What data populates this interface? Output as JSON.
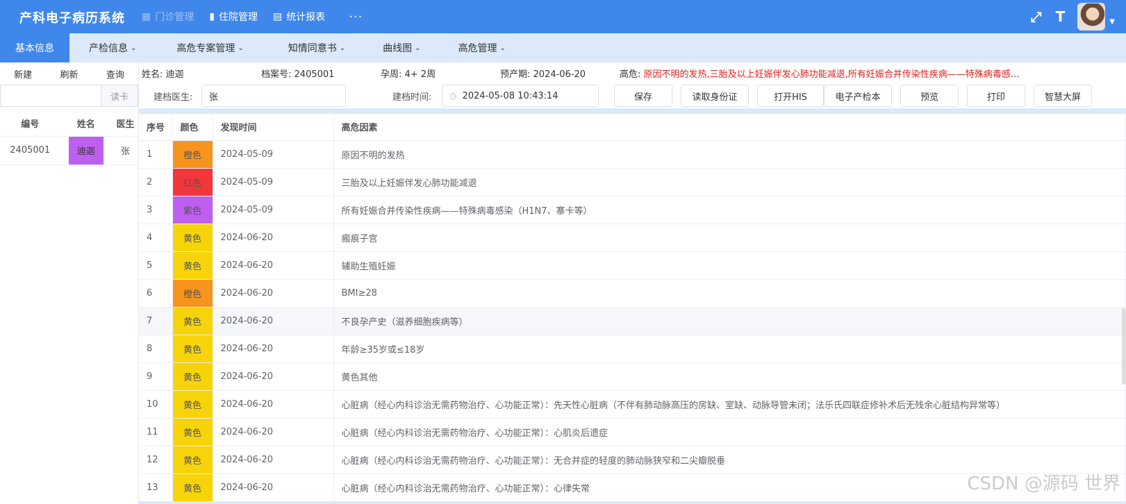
{
  "header": {
    "app_title": "产科电子病历系统",
    "nav": [
      {
        "label": "门诊管理",
        "icon": "grid-icon"
      },
      {
        "label": "住院管理",
        "icon": "bar-chart-icon"
      },
      {
        "label": "统计报表",
        "icon": "table-icon"
      }
    ],
    "more": "···"
  },
  "subnav": [
    {
      "label": "基本信息"
    },
    {
      "label": "产检信息"
    },
    {
      "label": "高危专案管理"
    },
    {
      "label": "知情同意书"
    },
    {
      "label": "曲线图"
    },
    {
      "label": "高危管理"
    }
  ],
  "sidebar": {
    "actions": [
      "新建",
      "刷新",
      "查询"
    ],
    "search_placeholder": "",
    "read_card": "读卡",
    "columns": [
      "编号",
      "姓名",
      "医生"
    ],
    "rows": [
      {
        "id": "2405001",
        "name": "迪迦",
        "doctor": "张"
      }
    ]
  },
  "patient": {
    "name_label": "姓名:",
    "name": "迪迦",
    "file_label": "档案号:",
    "file_no": "2405001",
    "gest_label": "孕周:",
    "gest": "4+ 2周",
    "due_label": "预产期:",
    "due": "2024-06-20",
    "risk_label": "高危:",
    "risk": "原因不明的发热,三胎及以上妊娠伴发心肺功能减退,所有妊娠合并传染性疾病——特殊病毒感染..."
  },
  "actions": {
    "doctor_label": "建档医生:",
    "doctor_value": "张",
    "time_label": "建档时间:",
    "time_value": "2024-05-08 10:43:14",
    "buttons": [
      "保存",
      "读取身份证",
      "打开HIS",
      "电子产检本",
      "预览",
      "打印",
      "智慧大屏"
    ]
  },
  "table": {
    "columns": [
      "序号",
      "颜色",
      "发现时间",
      "高危因素"
    ],
    "rows": [
      {
        "no": "1",
        "color": "橙色",
        "color_hex": "#f7941d",
        "date": "2024-05-09",
        "factor": "原因不明的发热"
      },
      {
        "no": "2",
        "color": "红色",
        "color_hex": "#f2373a",
        "date": "2024-05-09",
        "factor": "三胎及以上妊娠伴发心肺功能减退"
      },
      {
        "no": "3",
        "color": "紫色",
        "color_hex": "#bf5ff0",
        "date": "2024-05-09",
        "factor": "所有妊娠合并传染性疾病——特殊病毒感染（H1N7、寨卡等）"
      },
      {
        "no": "4",
        "color": "黄色",
        "color_hex": "#f7d40a",
        "date": "2024-06-20",
        "factor": "瘢痕子宫"
      },
      {
        "no": "5",
        "color": "黄色",
        "color_hex": "#f7d40a",
        "date": "2024-06-20",
        "factor": "辅助生殖妊娠"
      },
      {
        "no": "6",
        "color": "橙色",
        "color_hex": "#f7941d",
        "date": "2024-06-20",
        "factor": "BMI≥28"
      },
      {
        "no": "7",
        "color": "黄色",
        "color_hex": "#f7d40a",
        "date": "2024-06-20",
        "factor": "不良孕产史（滋养细胞疾病等）"
      },
      {
        "no": "8",
        "color": "黄色",
        "color_hex": "#f7d40a",
        "date": "2024-06-20",
        "factor": "年龄≥35岁或≤18岁"
      },
      {
        "no": "9",
        "color": "黄色",
        "color_hex": "#f7d40a",
        "date": "2024-06-20",
        "factor": "黄色其他"
      },
      {
        "no": "10",
        "color": "黄色",
        "color_hex": "#f7d40a",
        "date": "2024-06-20",
        "factor": "心脏病（经心内科诊治无需药物治疗、心功能正常）：先天性心脏病（不伴有肺动脉高压的房缺、室缺、动脉导管未闭；法乐氏四联症修补术后无残余心脏结构异常等）"
      },
      {
        "no": "11",
        "color": "黄色",
        "color_hex": "#f7d40a",
        "date": "2024-06-20",
        "factor": "心脏病（经心内科诊治无需药物治疗、心功能正常）：心肌炎后遗症"
      },
      {
        "no": "12",
        "color": "黄色",
        "color_hex": "#f7d40a",
        "date": "2024-06-20",
        "factor": "心脏病（经心内科诊治无需药物治疗、心功能正常）：无合并症的轻度的肺动脉狭窄和二尖瓣脱垂"
      },
      {
        "no": "13",
        "color": "黄色",
        "color_hex": "#f7d40a",
        "date": "2024-06-20",
        "factor": "心脏病（经心内科诊治无需药物治疗、心功能正常）：心律失常"
      }
    ]
  },
  "colors": {
    "primary": "#3f87ea",
    "subnav_bg": "#dbe9fb",
    "purple_name": "#bf5ff0",
    "risk_red": "#e02020"
  },
  "watermark": "CSDN @源码 世界"
}
